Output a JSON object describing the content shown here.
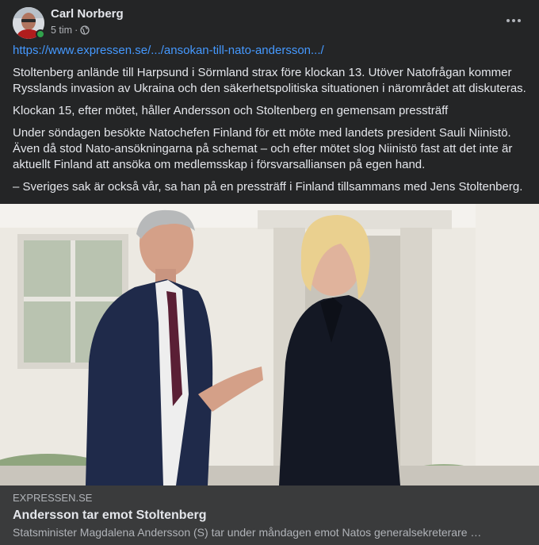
{
  "post": {
    "author": "Carl Norberg",
    "time": "5 tim",
    "separator": "·",
    "privacy_icon": "globe-icon",
    "menu_icon": "more-horizontal-icon"
  },
  "content": {
    "link": "https://www.expressen.se/.../ansokan-till-nato-andersson.../",
    "paragraphs": [
      "Stoltenberg anlände till Harpsund i Sörmland strax före klockan 13. Utöver Natofrågan kommer Rysslands invasion av Ukraina och den säkerhetspolitiska situationen i närområdet att diskuteras.",
      "Klockan 15, efter mötet, håller Andersson och Stoltenberg en gemensam pressträff",
      "Under söndagen besökte Natochefen Finland för ett möte med landets president Sauli Niinistö. Även då stod Nato-ansökningarna på schemat – och efter mötet slog Niinistö fast att det inte är aktuellt Finland att ansöka om medlemsskap i försvarsalliansen på egen hand.",
      "– Sveriges sak är också vår, sa han på en pressträff i Finland tillsammans med Jens Stoltenberg."
    ]
  },
  "link_preview": {
    "domain": "EXPRESSEN.SE",
    "title": "Andersson tar emot Stoltenberg",
    "description": "Statsminister Magdalena Andersson (S) tar under måndagen emot Natos generalsekreterare …"
  },
  "colors": {
    "background": "#242526",
    "preview_background": "#3a3b3c",
    "link": "#4599ff",
    "online": "#31a24c"
  }
}
